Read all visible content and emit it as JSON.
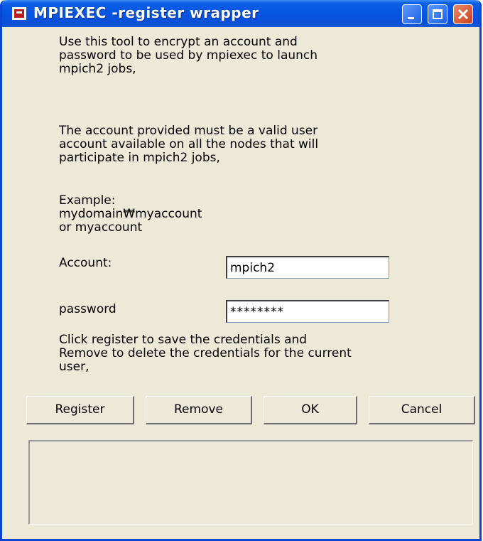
{
  "window": {
    "title": "MPIEXEC -register wrapper"
  },
  "content": {
    "intro": "Use this tool to encrypt an account and\npassword to be used by mpiexec to launch\nmpich2 jobs,",
    "account_note": "The account provided must be a valid user\naccount available on all the nodes that will\nparticipate in mpich2 jobs,",
    "example": "Example:\nmydomain₩myaccount\nor myaccount",
    "instructions": "Click register to save the credentials and\nRemove to delete the credentials for the current\nuser,"
  },
  "form": {
    "account_label": "Account:",
    "account_value": "mpich2",
    "password_label": "password",
    "password_value": "********"
  },
  "buttons": {
    "register": "Register",
    "remove": "Remove",
    "ok": "OK",
    "cancel": "Cancel"
  },
  "output": {
    "text": ""
  },
  "colors": {
    "titlebar": "#0654e1",
    "dialog_background": "#ece9d8",
    "close_button": "#c8401b"
  },
  "icons": {
    "app": "app-window-icon",
    "minimize": "minimize-icon",
    "maximize": "maximize-icon",
    "close": "close-icon"
  }
}
